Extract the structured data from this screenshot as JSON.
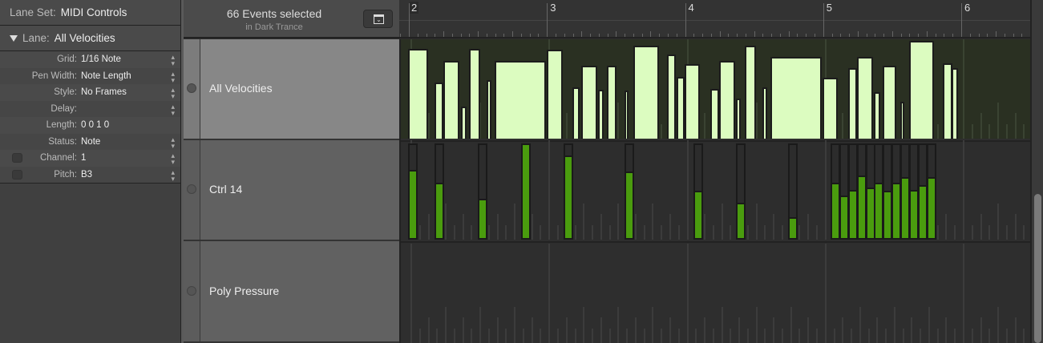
{
  "inspector": {
    "lane_set_label": "Lane Set:",
    "lane_set_value": "MIDI Controls",
    "lane_label": "Lane:",
    "lane_value": "All Velocities",
    "params": [
      {
        "key": "Grid:",
        "value": "1/16 Note",
        "stepper": true,
        "checkbox": false
      },
      {
        "key": "Pen Width:",
        "value": "Note Length",
        "stepper": true,
        "checkbox": false
      },
      {
        "key": "Style:",
        "value": "No Frames",
        "stepper": true,
        "checkbox": false
      },
      {
        "key": "Delay:",
        "value": "",
        "stepper": true,
        "checkbox": false
      },
      {
        "key": "Length:",
        "value": "0 0 1    0",
        "stepper": false,
        "checkbox": false
      },
      {
        "key": "Status:",
        "value": "Note",
        "stepper": true,
        "checkbox": false
      },
      {
        "key": "Channel:",
        "value": "1",
        "stepper": true,
        "checkbox": true
      },
      {
        "key": "Pitch:",
        "value": "B3",
        "stepper": true,
        "checkbox": true
      }
    ]
  },
  "header": {
    "title": "66 Events selected",
    "subtitle": "in Dark Trance"
  },
  "ruler": {
    "bars": [
      "2",
      "3",
      "4",
      "5",
      "6"
    ]
  },
  "lanes": [
    {
      "name": "All Velocities",
      "selected": true
    },
    {
      "name": "Ctrl 14",
      "selected": false
    },
    {
      "name": "Poly Pressure",
      "selected": false
    }
  ],
  "colors": {
    "velocity": "#dcfcc0",
    "controller": "#4a9c0e",
    "velocity_bg": "#2a3022"
  },
  "velocity_events": [
    [
      1.983,
      0.145,
      117
    ],
    [
      2.174,
      0.064,
      73
    ],
    [
      2.238,
      0.116,
      101
    ],
    [
      2.366,
      0.041,
      42
    ],
    [
      2.424,
      0.081,
      117
    ],
    [
      2.552,
      0.035,
      76
    ],
    [
      2.61,
      0.372,
      101
    ],
    [
      2.987,
      0.116,
      116
    ],
    [
      3.173,
      0.052,
      67
    ],
    [
      3.237,
      0.116,
      95
    ],
    [
      3.358,
      0.041,
      63
    ],
    [
      3.422,
      0.07,
      95
    ],
    [
      3.55,
      0.029,
      62
    ],
    [
      3.614,
      0.186,
      121
    ],
    [
      3.858,
      0.064,
      109
    ],
    [
      3.927,
      0.058,
      80
    ],
    [
      3.985,
      0.11,
      97
    ],
    [
      4.171,
      0.064,
      65
    ],
    [
      4.235,
      0.116,
      101
    ],
    [
      4.357,
      0.035,
      52
    ],
    [
      4.421,
      0.081,
      121
    ],
    [
      4.549,
      0.035,
      67
    ],
    [
      4.607,
      0.372,
      106
    ],
    [
      4.984,
      0.11,
      79
    ],
    [
      5.17,
      0.064,
      92
    ],
    [
      5.234,
      0.116,
      106
    ],
    [
      5.356,
      0.046,
      60
    ],
    [
      5.419,
      0.099,
      95
    ],
    [
      5.547,
      0.029,
      48
    ],
    [
      5.611,
      0.18,
      127
    ],
    [
      5.855,
      0.07,
      98
    ],
    [
      5.919,
      0.046,
      92
    ]
  ],
  "ctrl14_events": [
    [
      1.983,
      91
    ],
    [
      2.174,
      74
    ],
    [
      2.488,
      53
    ],
    [
      2.801,
      127
    ],
    [
      3.109,
      111
    ],
    [
      3.55,
      89
    ],
    [
      4.049,
      64
    ],
    [
      4.357,
      47
    ],
    [
      4.734,
      28
    ],
    [
      5.042,
      74
    ],
    [
      5.105,
      57
    ],
    [
      5.168,
      65
    ],
    [
      5.232,
      84
    ],
    [
      5.295,
      68
    ],
    [
      5.358,
      74
    ],
    [
      5.422,
      64
    ],
    [
      5.485,
      74
    ],
    [
      5.548,
      82
    ],
    [
      5.612,
      65
    ],
    [
      5.675,
      71
    ],
    [
      5.738,
      82
    ]
  ]
}
